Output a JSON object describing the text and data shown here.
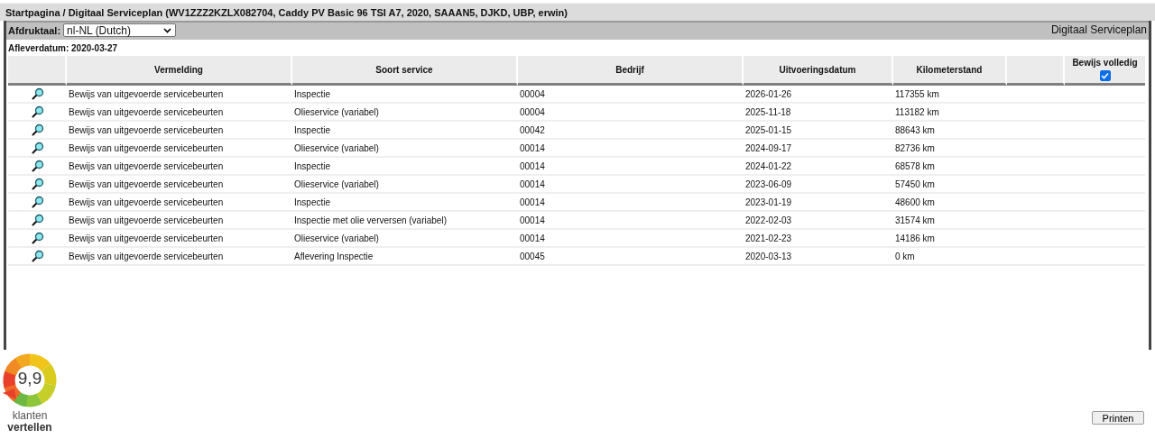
{
  "breadcrumb": "Startpagina / Digitaal Serviceplan (WV1ZZZ2KZLX082704, Caddy PV Basic 96 TSI A7, 2020, SAAAN5, DJKD, UBP, erwin)",
  "toolbar": {
    "language_label": "Afdruktaal:",
    "language_value": "nl-NL (Dutch)",
    "page_title": "Digitaal Serviceplan"
  },
  "delivery_date": "Afleverdatum: 2020-03-27",
  "table": {
    "columns": [
      "Vermelding",
      "Soort service",
      "Bedrijf",
      "Uitvoeringsdatum",
      "Kilometerstand",
      "Bewijs volledig"
    ],
    "complete_checkbox": {
      "checked": true
    },
    "rows": [
      {
        "entry": "Bewijs van uitgevoerde servicebeurten",
        "service": "Inspectie",
        "company": "00004",
        "date": "2026-01-26",
        "mileage": "117355 km"
      },
      {
        "entry": "Bewijs van uitgevoerde servicebeurten",
        "service": "Olieservice (variabel)",
        "company": "00004",
        "date": "2025-11-18",
        "mileage": "113182 km"
      },
      {
        "entry": "Bewijs van uitgevoerde servicebeurten",
        "service": "Inspectie",
        "company": "00042",
        "date": "2025-01-15",
        "mileage": "88643 km"
      },
      {
        "entry": "Bewijs van uitgevoerde servicebeurten",
        "service": "Olieservice (variabel)",
        "company": "00014",
        "date": "2024-09-17",
        "mileage": "82736 km"
      },
      {
        "entry": "Bewijs van uitgevoerde servicebeurten",
        "service": "Inspectie",
        "company": "00014",
        "date": "2024-01-22",
        "mileage": "68578 km"
      },
      {
        "entry": "Bewijs van uitgevoerde servicebeurten",
        "service": "Olieservice (variabel)",
        "company": "00014",
        "date": "2023-06-09",
        "mileage": "57450 km"
      },
      {
        "entry": "Bewijs van uitgevoerde servicebeurten",
        "service": "Inspectie",
        "company": "00014",
        "date": "2023-01-19",
        "mileage": "48600 km"
      },
      {
        "entry": "Bewijs van uitgevoerde servicebeurten",
        "service": "Inspectie met olie verversen (variabel)",
        "company": "00014",
        "date": "2022-02-03",
        "mileage": "31574 km"
      },
      {
        "entry": "Bewijs van uitgevoerde servicebeurten",
        "service": "Olieservice (variabel)",
        "company": "00014",
        "date": "2021-02-23",
        "mileage": "14186 km"
      },
      {
        "entry": "Bewijs van uitgevoerde servicebeurten",
        "service": "Aflevering Inspectie",
        "company": "00045",
        "date": "2020-03-13",
        "mileage": "0 km"
      }
    ]
  },
  "rating_badge": {
    "score": "9,9",
    "line_1": "klanten",
    "line_2": "vertellen"
  },
  "buttons": [
    "Printen"
  ]
}
